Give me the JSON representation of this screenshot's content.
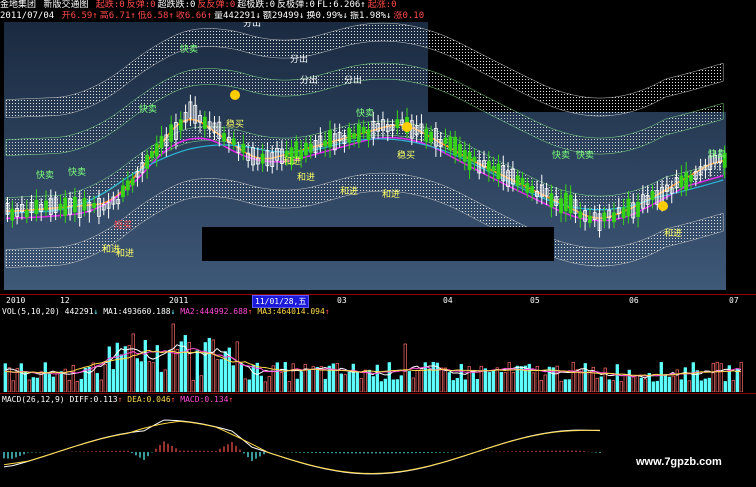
{
  "header_line1": {
    "stock_name": "金地集团",
    "window_title": "新版交通图",
    "indicators": [
      {
        "label": "起跌",
        "value": "0",
        "color": "#ff4a4a"
      },
      {
        "label": "反弹",
        "value": "0",
        "color": "#ff4a4a"
      },
      {
        "label": "超跌跌",
        "value": "0",
        "color": "#ffffff"
      },
      {
        "label": "反反弹",
        "value": "0",
        "color": "#ff4a4a"
      },
      {
        "label": "超极跌",
        "value": "0",
        "color": "#ffffff"
      },
      {
        "label": "反极弹",
        "value": "0",
        "color": "#ffffff"
      },
      {
        "label": "FL",
        "value": "6.206",
        "color": "#ffffff",
        "arrow": "↑"
      },
      {
        "label": "起涨",
        "value": "0",
        "color": "#ff4a4a"
      }
    ]
  },
  "header_line2": {
    "date": "2011/07/04",
    "open": {
      "label": "开",
      "value": "6.59",
      "arrow": "↑"
    },
    "high": {
      "label": "高",
      "value": "6.71",
      "arrow": "↑"
    },
    "low": {
      "label": "低",
      "value": "6.58",
      "arrow": "↑"
    },
    "close": {
      "label": "收",
      "value": "6.66",
      "arrow": "↑"
    },
    "volume": {
      "label": "量",
      "value": "442291",
      "arrow": "↓"
    },
    "amount": {
      "label": "额",
      "value": "29499",
      "arrow": "↓"
    },
    "turnover": {
      "label": "换",
      "value": "0.99%",
      "arrow": "↓"
    },
    "amplitude": {
      "label": "振",
      "value": "1.98%",
      "arrow": "↓"
    },
    "change": {
      "label": "涨",
      "value": "0.10"
    }
  },
  "chart_labels": {
    "fen_chu": "分出",
    "kuai_mai": "快卖",
    "he_jin": "和进",
    "duan_mai": "短买",
    "pin_mai": "稳买"
  },
  "time_axis": {
    "labels": [
      "2010",
      "12",
      "2011",
      "03",
      "04",
      "05",
      "06",
      "07"
    ],
    "cursor_label": "11/01/28,五"
  },
  "volume_panel": {
    "title": "VOL(5,10,20)",
    "vol": "442291",
    "vol_arrow": "↓",
    "ma1": "MA1:493660.188",
    "ma1_arrow": "↓",
    "ma2": "MA2:444992.688",
    "ma2_arrow": "↑",
    "ma3": "MA3:464014.094",
    "ma3_arrow": "↑"
  },
  "macd_panel": {
    "title": "MACD(26,12,9)",
    "diff": "DIFF:0.113",
    "diff_arrow": "↑",
    "dea": "DEA:0.046",
    "dea_arrow": "↑",
    "macd": "MACD:0.134",
    "macd_arrow": "↑"
  },
  "watermark": "www.7gpzb.com",
  "colors": {
    "up": "#ff3b3b",
    "down": "#5effff",
    "green_candle": "#36d31a",
    "white_candle": "#ffffff",
    "ma_orange": "#ff8c1a",
    "ma_magenta": "#e028e8",
    "ma_cyan": "#2bb5d8",
    "band": "#e8e8e8",
    "macd_yellow": "#ffd94a"
  }
}
